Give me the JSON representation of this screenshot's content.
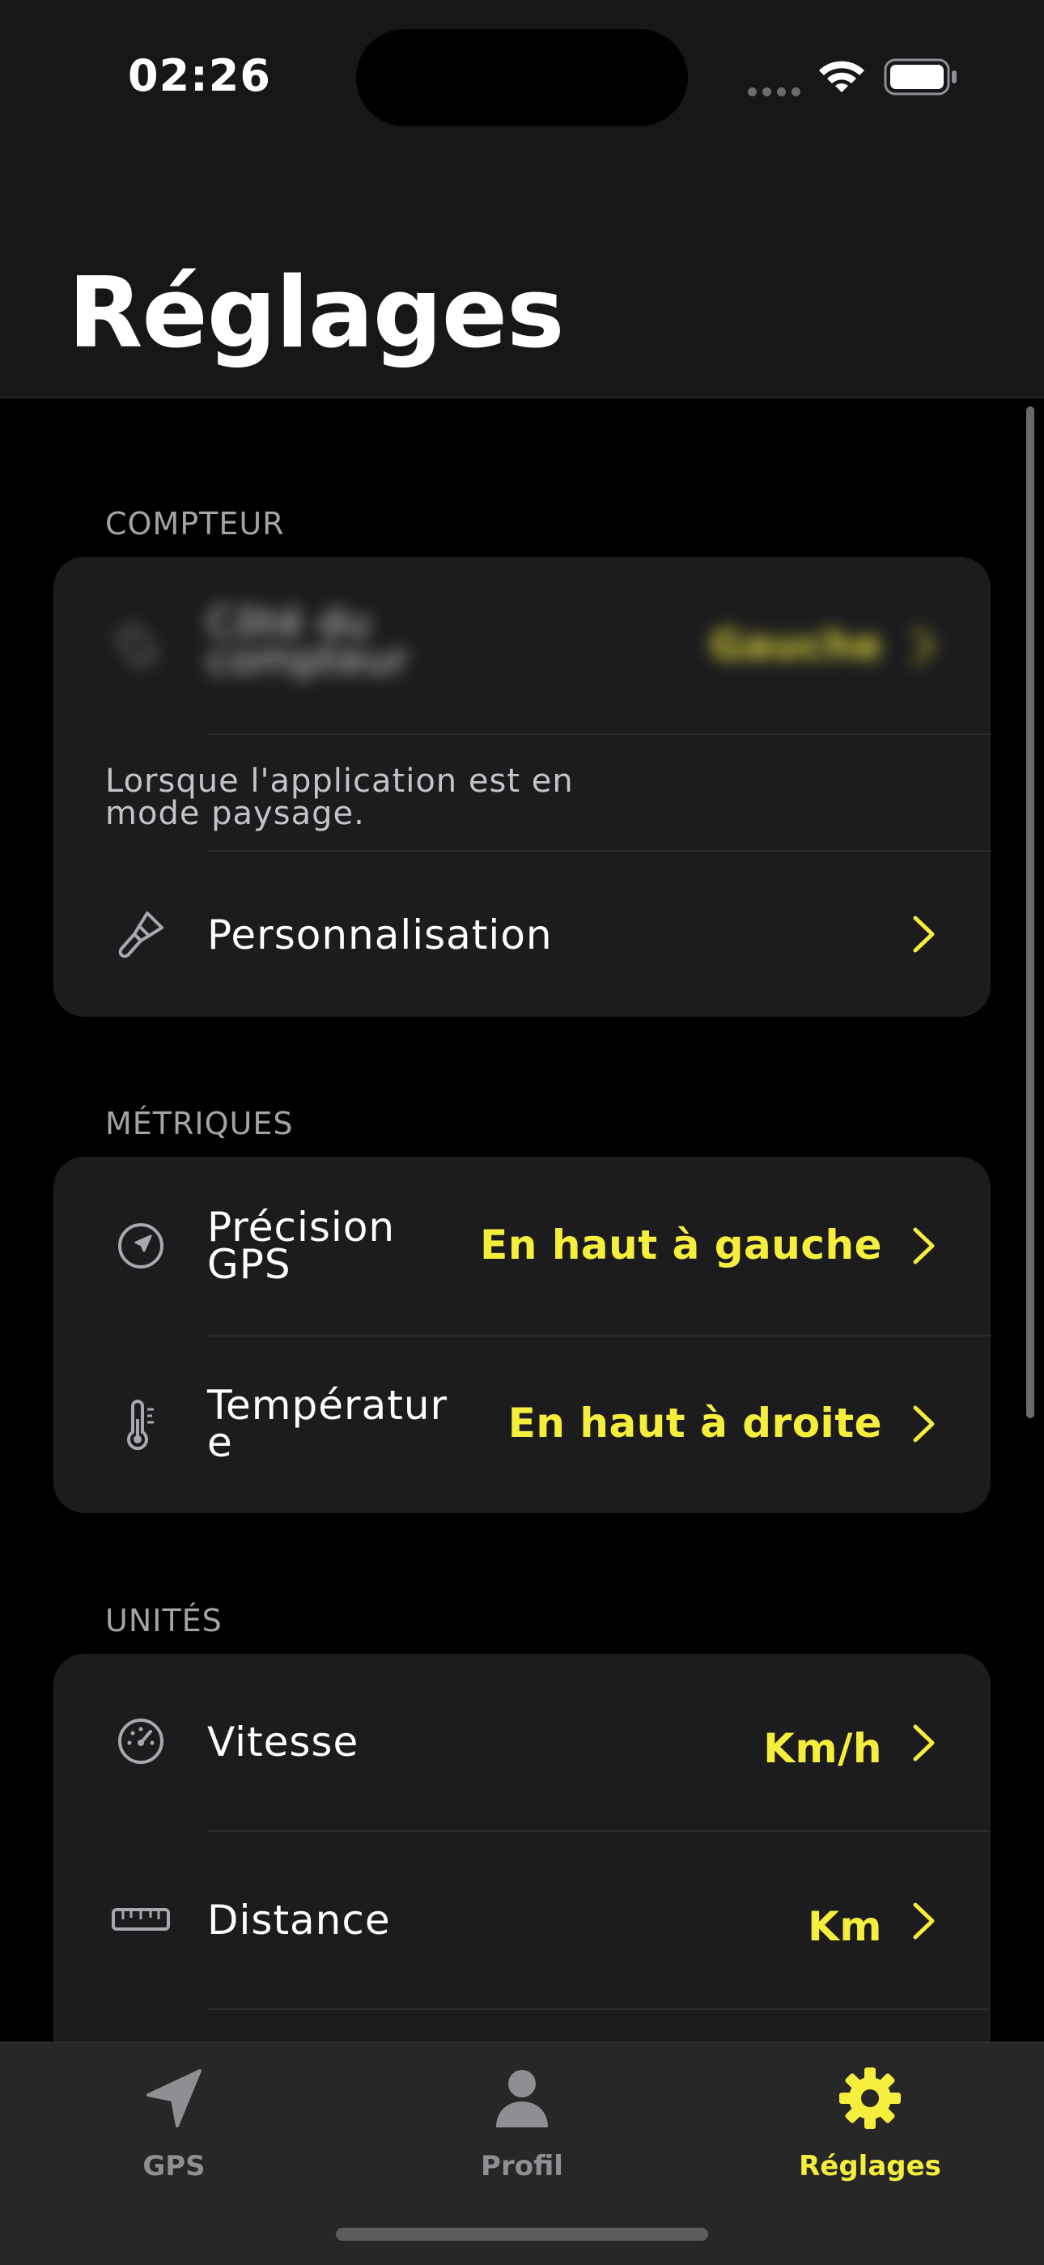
{
  "status_bar": {
    "time": "02:26",
    "icons": [
      "cellular-dots-icon",
      "wifi-icon",
      "battery-icon"
    ]
  },
  "header": {
    "title": "Réglages"
  },
  "sections": {
    "compteur": {
      "label": "COMPTEUR",
      "rows": [
        {
          "icon": "phone-rotate-icon",
          "label_line1": "Côté du",
          "label_line2": "compteur",
          "value": "Gauche"
        },
        {
          "icon": "paintbrush-icon",
          "label": "Personnalisation"
        }
      ],
      "note_line1": "Lorsque l'application est en",
      "note_line2": "mode paysage."
    },
    "metriques": {
      "label": "MÉTRIQUES",
      "rows": [
        {
          "icon": "location-arrow-icon",
          "label_line1": "Précision",
          "label_line2": "GPS",
          "value": "En haut à gauche"
        },
        {
          "icon": "thermometer-icon",
          "label_line1": "Températur",
          "label_line2": "e",
          "value": "En haut à droite"
        }
      ]
    },
    "unites": {
      "label": "UNITÉS",
      "rows": [
        {
          "icon": "speedometer-icon",
          "label": "Vitesse",
          "value": "Km/h"
        },
        {
          "icon": "ruler-icon",
          "label": "Distance",
          "value": "Km"
        }
      ]
    }
  },
  "tab_bar": {
    "tabs": [
      {
        "label": "GPS",
        "icon": "navigation-arrow-icon",
        "active": false
      },
      {
        "label": "Profil",
        "icon": "person-icon",
        "active": false
      },
      {
        "label": "Réglages",
        "icon": "gear-icon",
        "active": true
      }
    ]
  },
  "colors": {
    "accent": "#f5ee3d",
    "background": "#000000",
    "card": "#1c1c1e",
    "header": "#161718"
  }
}
